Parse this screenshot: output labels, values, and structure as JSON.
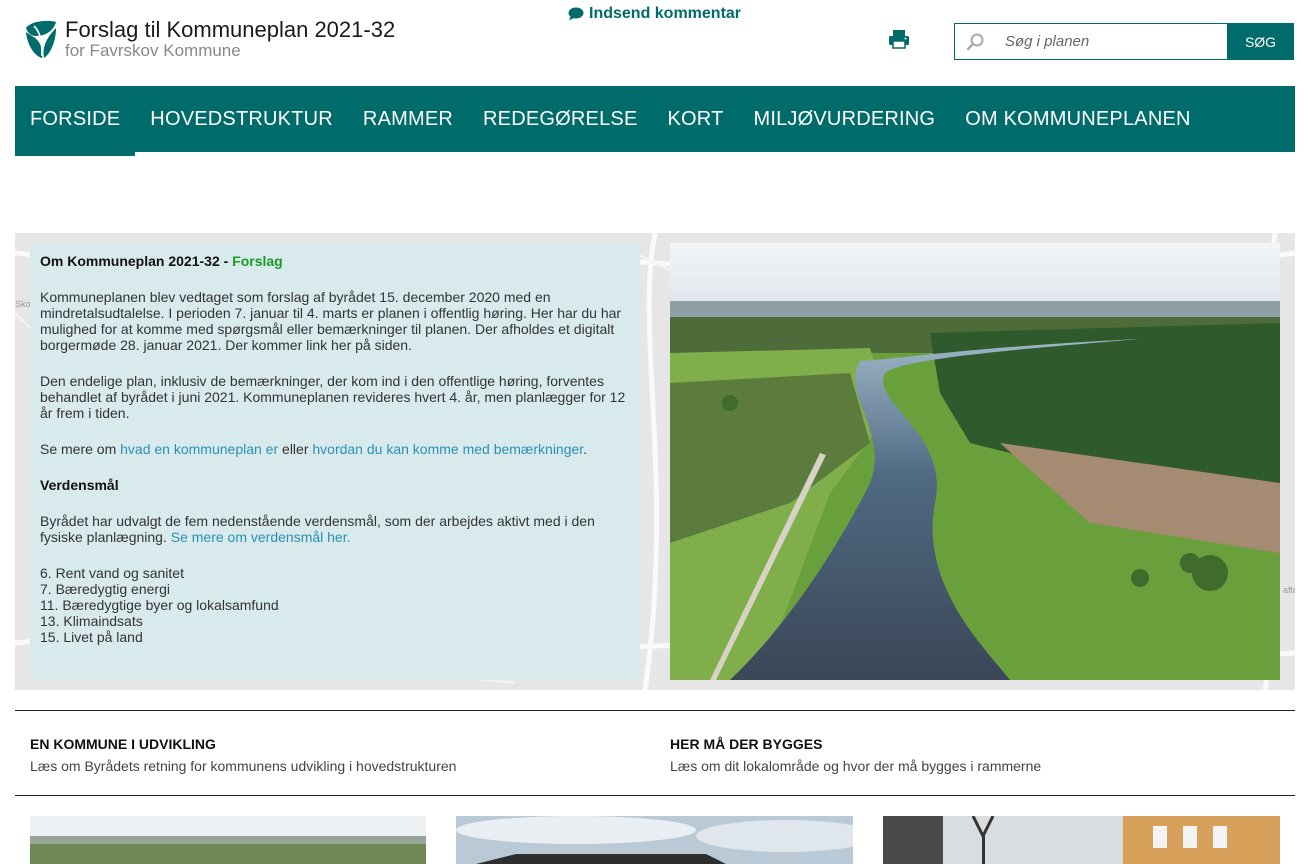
{
  "header": {
    "title": "Forslag til Kommuneplan 2021-32",
    "subtitle": "for Favrskov Kommune",
    "comment_link": "Indsend kommentar",
    "search_placeholder": "Søg i planen",
    "search_button": "SØG"
  },
  "nav": {
    "items": [
      "FORSIDE",
      "HOVEDSTRUKTUR",
      "RAMMER",
      "REDEGØRELSE",
      "KORT",
      "MILJØVURDERING",
      "OM KOMMUNEPLANEN"
    ],
    "active": "FORSIDE"
  },
  "intro": {
    "heading_prefix": "Om Kommuneplan 2021-32 - ",
    "heading_status": "Forslag",
    "para1": "Kommuneplanen blev vedtaget som forslag af byrådet 15. december 2020 med en mindretalsudtalelse. I perioden 7. januar til 4. marts er planen i offentlig høring. Her har du har mulighed for at komme med spørgsmål eller bemærkninger til planen. Der afholdes et digitalt borgermøde 28. januar 2021. Der kommer link her på siden.",
    "para2": "Den endelige plan, inklusiv de bemærkninger, der kom ind i den offentlige høring, forventes behandlet af byrådet i juni 2021. Kommuneplanen revideres hvert 4. år, men planlægger for 12 år frem i tiden.",
    "see_more_prefix": "Se mere om ",
    "link1": "hvad en kommuneplan er",
    "see_more_mid": " eller ",
    "link2": "hvordan du kan komme med bemærkninger",
    "see_more_suffix": ".",
    "goals_heading": "Verdensmål",
    "goals_text": "Byrådet har udvalgt de fem nedenstående verdensmål, som der arbejdes aktivt med i den fysiske planlægning. ",
    "goals_link": "Se mere om verdensmål her.",
    "goals": [
      "6. Rent vand og sanitet",
      "7. Bæredygtig energi",
      "11. Bæredygtige byer og lokalsamfund",
      "13. Klimaindsats",
      "15. Livet på land"
    ]
  },
  "map_labels": [
    "Sko",
    "aften"
  ],
  "teasers": [
    {
      "title": "EN KOMMUNE I UDVIKLING",
      "text": "Læs om Byrådets retning for kommunens udvikling i hovedstrukturen"
    },
    {
      "title": "HER MÅ DER BYGGES",
      "text": "Læs om dit lokalområde og hvor der må bygges i rammerne"
    }
  ],
  "colors": {
    "brand": "#006b6b",
    "intro_bg": "#d9eaed",
    "link": "#2b8fb8",
    "status_green": "#1a9a28"
  }
}
